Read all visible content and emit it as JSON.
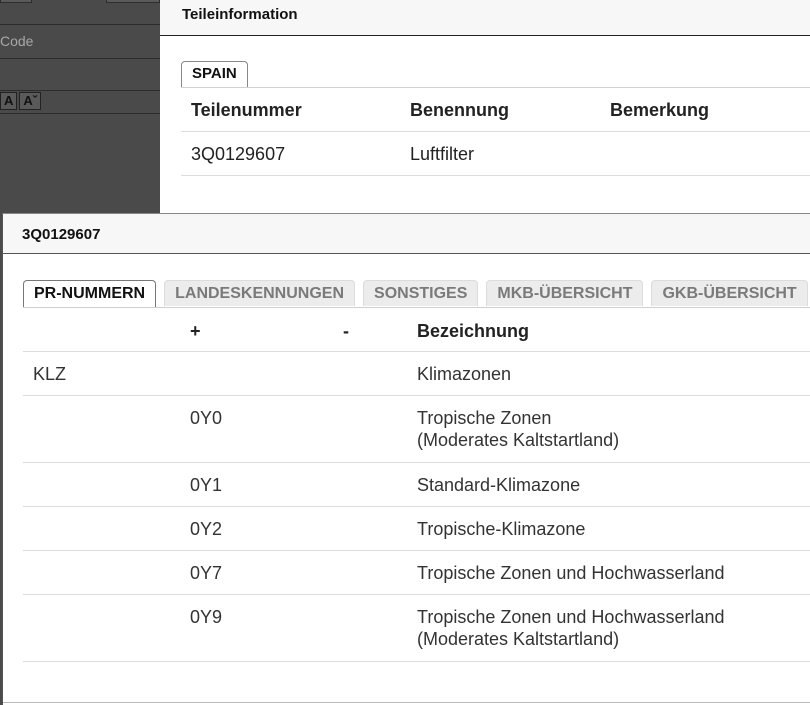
{
  "background": {
    "left_panel": {
      "code_placeholder": "Code",
      "font_tools": [
        "A",
        "Aˇ"
      ]
    },
    "section_title": "Teileinformation",
    "country_tab": "SPAIN",
    "table": {
      "headers": [
        "Teilenummer",
        "Benennung",
        "Bemerkung"
      ],
      "rows": [
        {
          "teilenummer": "3Q0129607",
          "benennung": "Luftfilter",
          "bemerkung": ""
        }
      ]
    }
  },
  "modal": {
    "title": "3Q0129607",
    "tabs": [
      {
        "label": "PR-NUMMERN",
        "active": true
      },
      {
        "label": "LANDESKENNUNGEN",
        "active": false
      },
      {
        "label": "SONSTIGES",
        "active": false
      },
      {
        "label": "MKB-ÜBERSICHT",
        "active": false
      },
      {
        "label": "GKB-ÜBERSICHT",
        "active": false
      }
    ],
    "table": {
      "headers": {
        "code": "",
        "plus": "+",
        "minus": "-",
        "desc": "Bezeichnung"
      },
      "rows": [
        {
          "code": "KLZ",
          "plus": "",
          "minus": "",
          "desc": [
            "Klimazonen"
          ]
        },
        {
          "code": "",
          "plus": "0Y0",
          "minus": "",
          "desc": [
            "Tropische Zonen",
            "(Moderates Kaltstartland)"
          ]
        },
        {
          "code": "",
          "plus": "0Y1",
          "minus": "",
          "desc": [
            "Standard-Klimazone"
          ]
        },
        {
          "code": "",
          "plus": "0Y2",
          "minus": "",
          "desc": [
            "Tropische-Klimazone"
          ]
        },
        {
          "code": "",
          "plus": "0Y7",
          "minus": "",
          "desc": [
            "Tropische Zonen und Hochwasserland"
          ]
        },
        {
          "code": "",
          "plus": "0Y9",
          "minus": "",
          "desc": [
            "Tropische Zonen und Hochwasserland",
            "(Moderates Kaltstartland)"
          ]
        }
      ]
    }
  }
}
